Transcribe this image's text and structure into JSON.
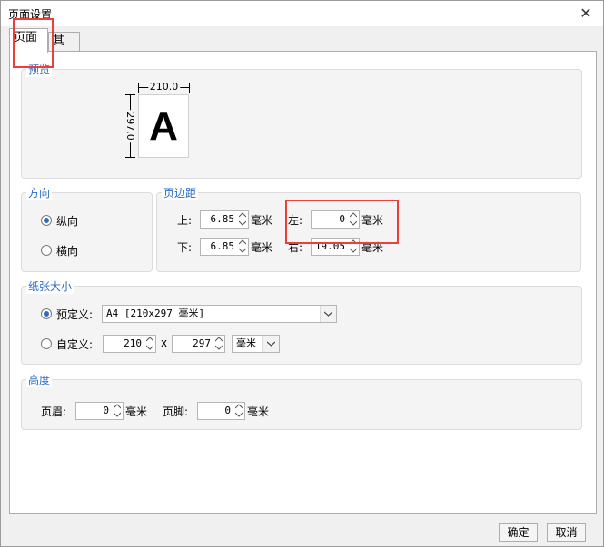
{
  "window": {
    "title": "页面设置"
  },
  "tabs": {
    "page": "页面",
    "other": "其他"
  },
  "preview": {
    "title": "预览",
    "width_label": "210.0",
    "height_label": "297.0",
    "sample_letter": "A"
  },
  "orientation": {
    "title": "方向",
    "portrait": "纵向",
    "landscape": "横向",
    "selected": "portrait"
  },
  "margins": {
    "title": "页边距",
    "top_label": "上:",
    "top_value": "6.85",
    "bottom_label": "下:",
    "bottom_value": "6.85",
    "left_label": "左:",
    "left_value": "0",
    "right_label": "右:",
    "right_value": "19.05",
    "unit": "毫米"
  },
  "paper_size": {
    "title": "纸张大小",
    "preset_label": "预定义:",
    "preset_value": "A4 [210x297 毫米]",
    "custom_label": "自定义:",
    "custom_width": "210",
    "times": "x",
    "custom_height": "297",
    "unit_value": "毫米",
    "selected": "preset"
  },
  "height": {
    "title": "高度",
    "header_label": "页眉:",
    "header_value": "0",
    "footer_label": "页脚:",
    "footer_value": "0",
    "unit": "毫米"
  },
  "buttons": {
    "ok": "确定",
    "cancel": "取消"
  },
  "annotation_color": "#e8413c",
  "accent_color": "#2a6cc4"
}
